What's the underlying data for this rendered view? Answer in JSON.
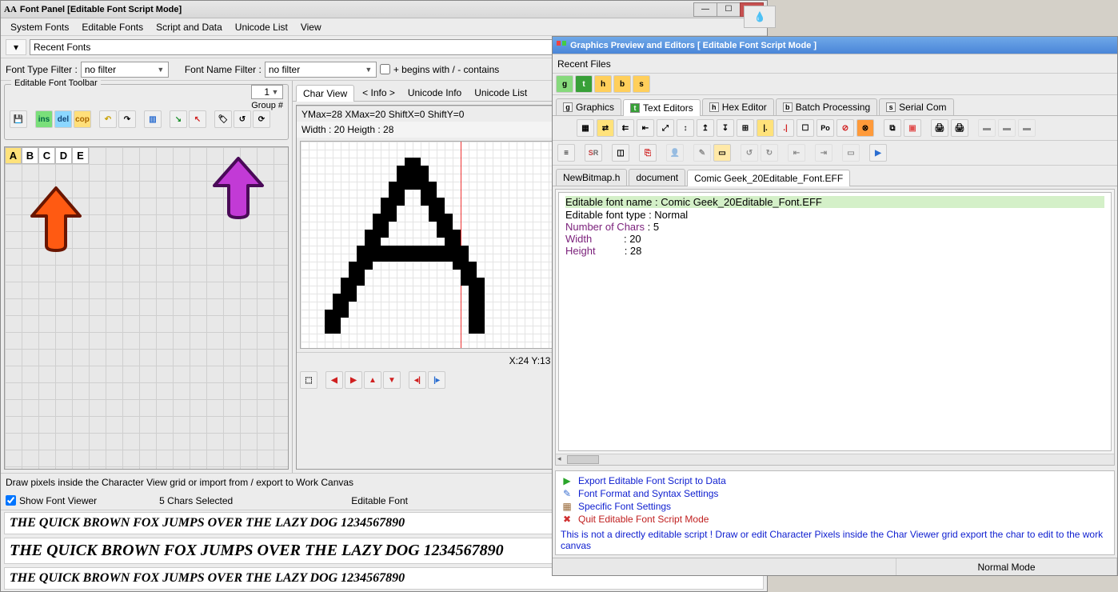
{
  "leftWin": {
    "title": "Font Panel [Editable Font Script Mode]",
    "icon": "AA",
    "menu": [
      "System Fonts",
      "Editable Fonts",
      "Script and Data",
      "Unicode List",
      "View"
    ],
    "recentLabel": "Recent Fonts",
    "filterTypeLabel": "Font Type Filter :",
    "filterTypeValue": "no filter",
    "filterNameLabel": "Font Name Filter :",
    "filterNameValue": "no filter",
    "filterModeLabel": "+ begins with / - contains",
    "groupTitle": "Editable Font Toolbar",
    "groupNumLabel": "Group #",
    "groupNumValue": "1",
    "chars": [
      "A",
      "B",
      "C",
      "D",
      "E"
    ],
    "charViewTabs": [
      "Char View",
      "< Info >",
      "Unicode Info",
      "Unicode List"
    ],
    "metrics": "YMax=28  XMax=20  ShiftX=0  ShiftY=0",
    "widthLabel": "Width : 20  Heigth : 28",
    "cursorPos": "X:24 Y:13",
    "hint": "Draw pixels inside the Character View grid or import from / export to Work Canvas",
    "showViewerLabel": "Show Font Viewer",
    "selCount": "5 Chars Selected",
    "editableLabel": "Editable Font",
    "sample": "The Quick Brown Fox Jumps over the Lazy Dog 1234567890"
  },
  "rightWin": {
    "title": "Graphics Preview and Editors [ Editable Font Script Mode ]",
    "recentLabel": "Recent Files",
    "letterTabs": [
      {
        "l": "g",
        "bg": "#86d97c"
      },
      {
        "l": "t",
        "bg": "#38a038",
        "fg": "#fff"
      },
      {
        "l": "h",
        "bg": "#ffcf5b"
      },
      {
        "l": "b",
        "bg": "#ffcf5b"
      },
      {
        "l": "s",
        "bg": "#ffcf5b"
      }
    ],
    "mainTabs": [
      {
        "l": "g",
        "label": "Graphics"
      },
      {
        "l": "t",
        "label": "Text Editors",
        "active": true,
        "bg": "#38a038",
        "fg": "#fff"
      },
      {
        "l": "h",
        "label": "Hex Editor"
      },
      {
        "l": "b",
        "label": "Batch Processing"
      },
      {
        "l": "s",
        "label": "Serial Com"
      }
    ],
    "docTabs": [
      "NewBitmap.h",
      "document",
      "Comic Geek_20Editable_Font.EFF"
    ],
    "editorLines": [
      {
        "t": "Editable font name : Comic Geek_20Editable_Font.EFF",
        "hl": true
      },
      {
        "t": "Editable font type : Normal"
      },
      {
        "k": "Number of Chars",
        "v": ": 5"
      },
      {
        "k": "Width",
        "v": ": 20"
      },
      {
        "k": "Height",
        "v": ": 28"
      }
    ],
    "actions": [
      {
        "label": "Export Editable Font Script to Data",
        "icon": "▶",
        "ic": "#2aa52a"
      },
      {
        "label": "Font Format and Syntax Settings",
        "icon": "✎",
        "ic": "#3a6fd0"
      },
      {
        "label": "Specific Font Settings",
        "icon": "▦",
        "ic": "#9a6a3a"
      },
      {
        "label": "Quit Editable Font Script Mode",
        "icon": "✖",
        "ic": "#d03030",
        "red": true
      }
    ],
    "note": "This is not a directly editable script ! Draw or edit Character Pixels inside the Char Viewer grid export the char to edit to the work canvas",
    "status": "Normal Mode"
  }
}
